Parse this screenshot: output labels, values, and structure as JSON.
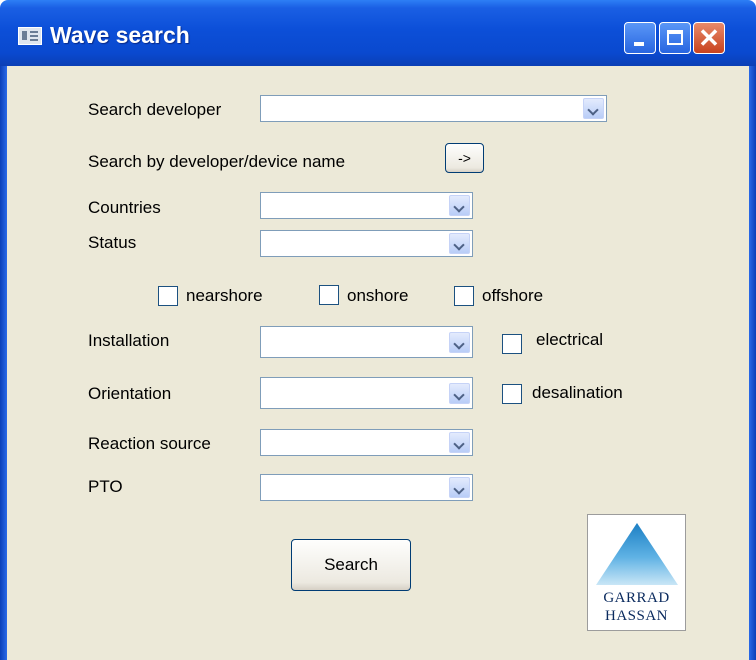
{
  "window": {
    "title": "Wave search"
  },
  "form": {
    "search_developer_label": "Search developer",
    "search_developer_value": "",
    "search_by_name_label": "Search by developer/device name",
    "go_button_label": "->",
    "countries_label": "Countries",
    "countries_value": "",
    "status_label": "Status",
    "status_value": "",
    "nearshore_label": "nearshore",
    "onshore_label": "onshore",
    "offshore_label": "offshore",
    "nearshore_checked": false,
    "onshore_checked": false,
    "offshore_checked": false,
    "installation_label": "Installation",
    "installation_value": "",
    "electrical_label": "electrical",
    "electrical_checked": false,
    "orientation_label": "Orientation",
    "orientation_value": "",
    "desalination_label": "desalination",
    "desalination_checked": false,
    "reaction_source_label": "Reaction source",
    "reaction_source_value": "",
    "pto_label": "PTO",
    "pto_value": "",
    "search_button_label": "Search"
  },
  "logo": {
    "line1": "GARRAD",
    "line2": "HASSAN"
  },
  "colors": {
    "titlebar": "#0a49cf",
    "client_bg": "#ece9d8",
    "close_button": "#c8421e"
  }
}
